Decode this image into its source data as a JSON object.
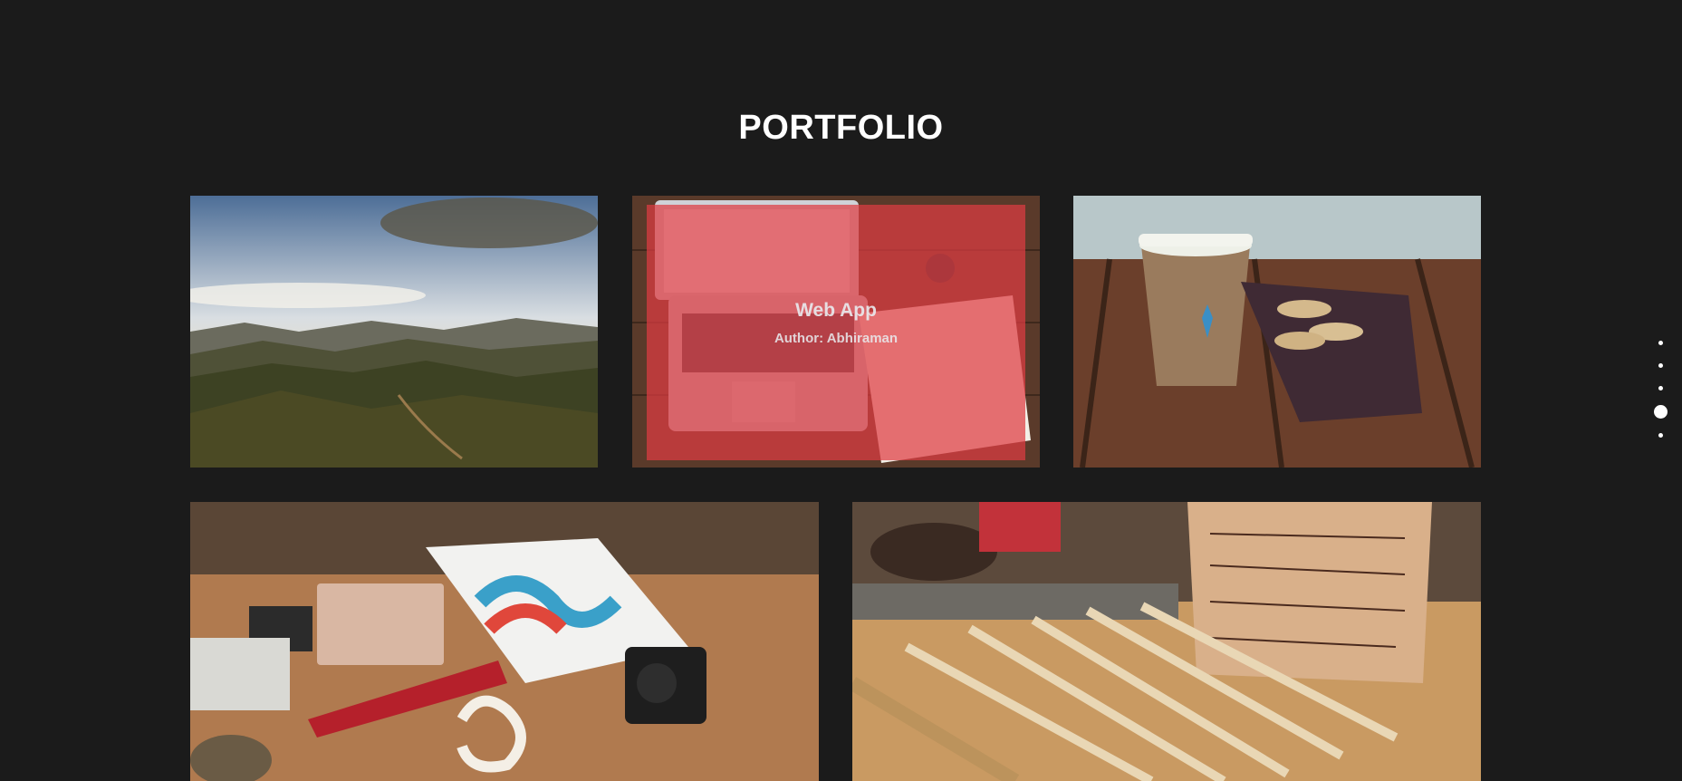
{
  "section": {
    "title": "PORTFOLIO"
  },
  "portfolio": {
    "items": [
      {
        "image": "mountain-landscape"
      },
      {
        "image": "laptop-desk",
        "overlay_title": "Web App",
        "overlay_author": "Author: Abhiraman"
      },
      {
        "image": "coffee-cup-macarons"
      },
      {
        "image": "back-to-school-flatlay"
      },
      {
        "image": "rulers-codfish-box"
      }
    ]
  },
  "nav_dots": {
    "count": 5,
    "active_index": 3
  },
  "colors": {
    "background": "#1b1b1b",
    "overlay": "#de3c42",
    "title": "#ffffff"
  }
}
